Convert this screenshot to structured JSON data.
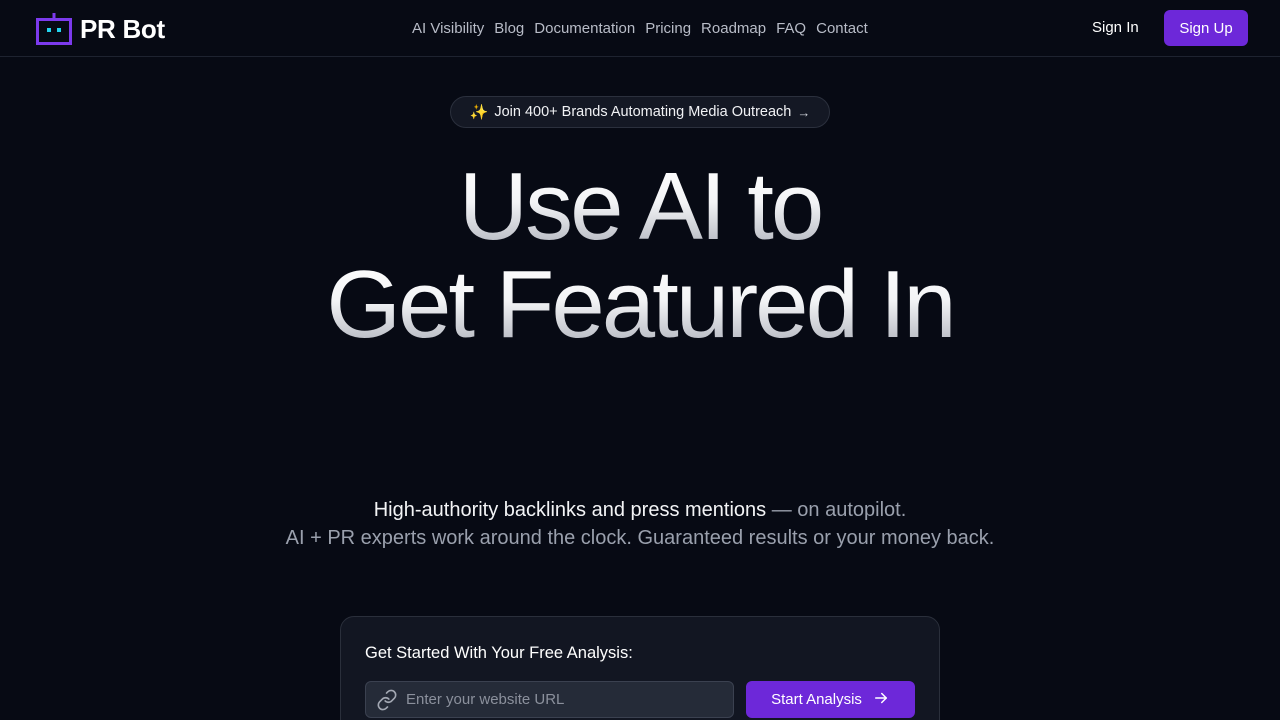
{
  "brand": {
    "name": "PR Bot",
    "logo_icon": "robot-icon",
    "accent": "#6d28d9",
    "logo_color": "#7c3aed",
    "logo_eye_color": "#22d3ee"
  },
  "nav": {
    "items": [
      {
        "label": "AI Visibility"
      },
      {
        "label": "Blog"
      },
      {
        "label": "Documentation"
      },
      {
        "label": "Pricing"
      },
      {
        "label": "Roadmap"
      },
      {
        "label": "FAQ"
      },
      {
        "label": "Contact"
      }
    ],
    "sign_in": "Sign In",
    "sign_up": "Sign Up"
  },
  "badge": {
    "icon": "✨",
    "text": "Join 400+ Brands Automating Media Outreach",
    "arrow": "→"
  },
  "hero": {
    "line1": "Use AI to",
    "line2": "Get Featured In"
  },
  "subheading": {
    "strong": "High-authority backlinks and press mentions",
    "rest1": " — on autopilot.",
    "line2": "AI + PR experts work around the clock. Guaranteed results or your money back."
  },
  "analysis_card": {
    "title": "Get Started With Your Free Analysis:",
    "input_placeholder": "Enter your website URL",
    "input_icon": "link-icon",
    "button_label": "Start Analysis",
    "button_icon": "arrow-right-icon"
  }
}
